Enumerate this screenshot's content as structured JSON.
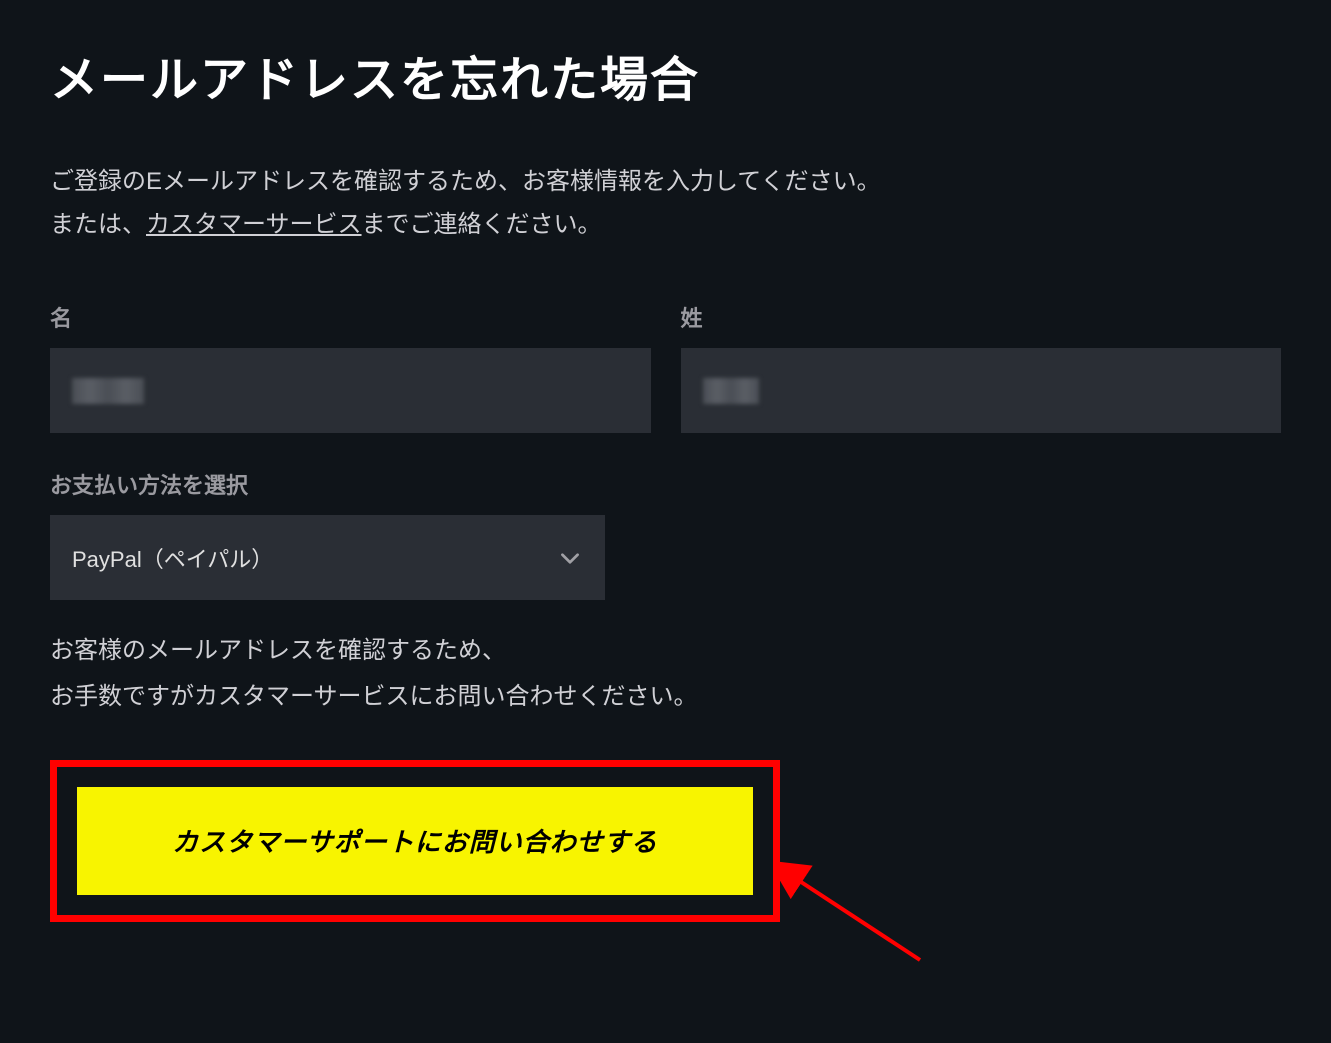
{
  "title": "メールアドレスを忘れた場合",
  "description": {
    "line1": "ご登録のEメールアドレスを確認するため、お客様情報を入力してください。",
    "line2_prefix": "または、",
    "link_text": "カスタマーサービス",
    "line2_suffix": "までご連絡ください。"
  },
  "form": {
    "first_name_label": "名",
    "last_name_label": "姓",
    "payment_label": "お支払い方法を選択",
    "payment_selected": "PayPal（ペイパル）"
  },
  "info": {
    "line1": "お客様のメールアドレスを確認するため、",
    "line2": "お手数ですがカスタマーサービスにお問い合わせください。"
  },
  "button": {
    "contact_label": "カスタマーサポートにお問い合わせする"
  }
}
